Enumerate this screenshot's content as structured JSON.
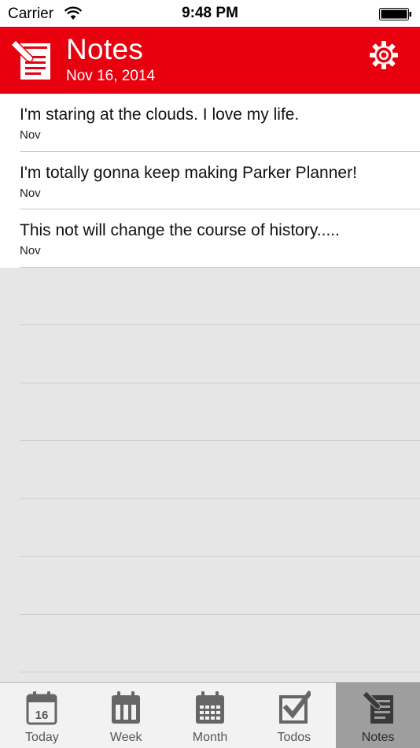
{
  "status_bar": {
    "carrier": "Carrier",
    "time": "9:48 PM",
    "icons": [
      "wifi-icon",
      "battery-icon"
    ]
  },
  "header": {
    "title": "Notes",
    "date": "Nov 16, 2014",
    "icon": "notes-icon",
    "settings_icon": "gear-icon",
    "background_color": "#e8000e"
  },
  "notes": [
    {
      "title": "I'm staring at the clouds. I love my life.",
      "date": "Nov"
    },
    {
      "title": "I'm totally gonna keep making Parker Planner!",
      "date": "Nov"
    },
    {
      "title": "This not will change the course of history.....",
      "date": "Nov"
    }
  ],
  "tab_bar": {
    "tabs": [
      {
        "label": "Today",
        "icon": "calendar-day-icon",
        "day": "16",
        "active": false
      },
      {
        "label": "Week",
        "icon": "calendar-week-icon",
        "active": false
      },
      {
        "label": "Month",
        "icon": "calendar-month-icon",
        "active": false
      },
      {
        "label": "Todos",
        "icon": "checkbox-icon",
        "active": false
      },
      {
        "label": "Notes",
        "icon": "notes-icon",
        "active": true
      }
    ]
  }
}
